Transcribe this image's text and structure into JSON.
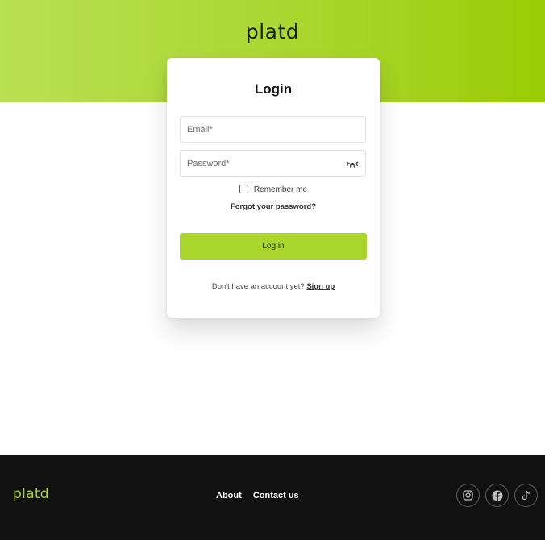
{
  "brand": {
    "name": "platd"
  },
  "login": {
    "title": "Login",
    "email_placeholder": "Email*",
    "password_placeholder": "Password*",
    "remember_label": "Remember me",
    "forgot_link": "Forgot your password?",
    "submit_label": "Log in",
    "signup_prompt": "Don't have an account yet?",
    "signup_link": "Sign up"
  },
  "footer": {
    "brand": "platd",
    "nav": [
      "About",
      "Contact us"
    ],
    "social_icons": [
      "instagram-icon",
      "facebook-icon",
      "tiktok-icon"
    ]
  },
  "colors": {
    "accent": "#a9d52d",
    "hero_gradient_start": "#b9df52",
    "hero_gradient_end": "#9bcc05",
    "footer_bg": "#111111"
  }
}
